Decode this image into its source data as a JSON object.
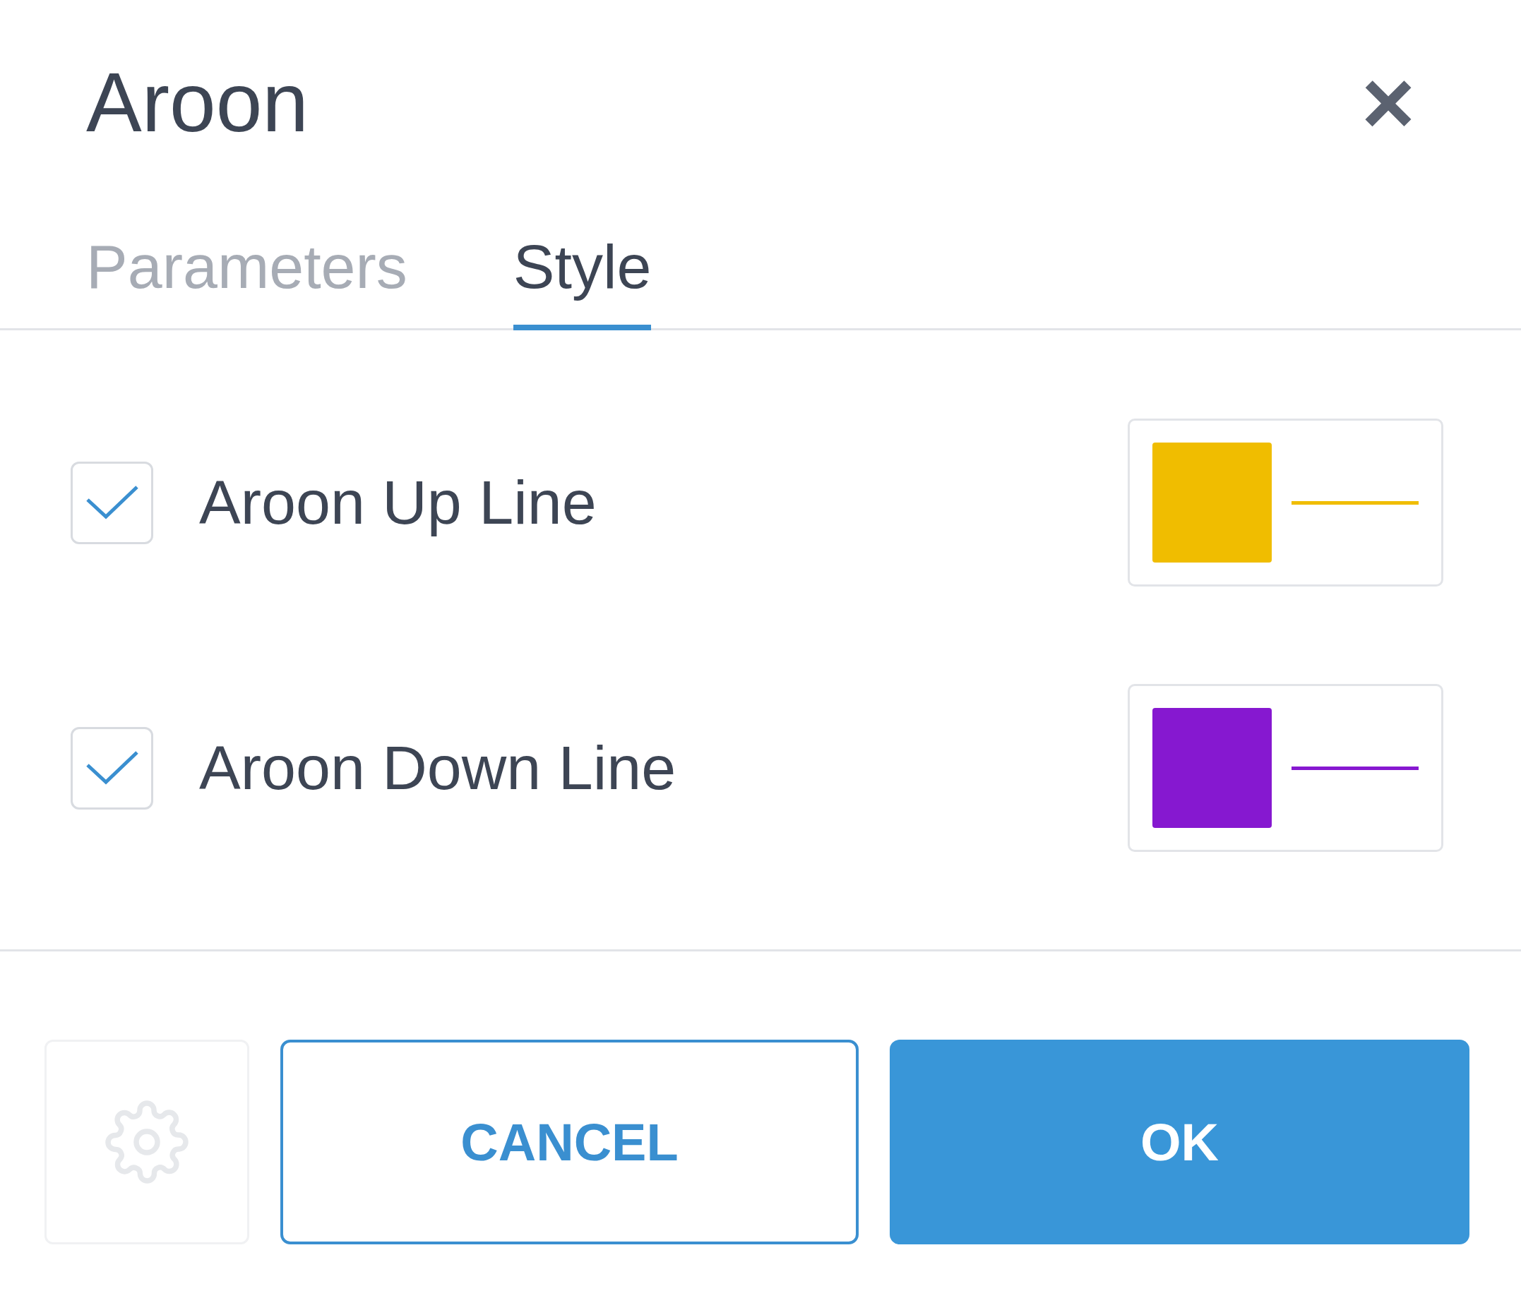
{
  "dialog": {
    "title": "Aroon",
    "close": "×"
  },
  "tabs": [
    {
      "label": "Parameters",
      "selected": false
    },
    {
      "label": "Style",
      "selected": true
    }
  ],
  "lines": [
    {
      "label": "Aroon Up Line",
      "checked": true,
      "color": "#f0bd00"
    },
    {
      "label": "Aroon Down Line",
      "checked": true,
      "color": "#8618d0"
    }
  ],
  "footer": {
    "settings_disabled": true,
    "cancel": "CANCEL",
    "ok": "OK"
  }
}
